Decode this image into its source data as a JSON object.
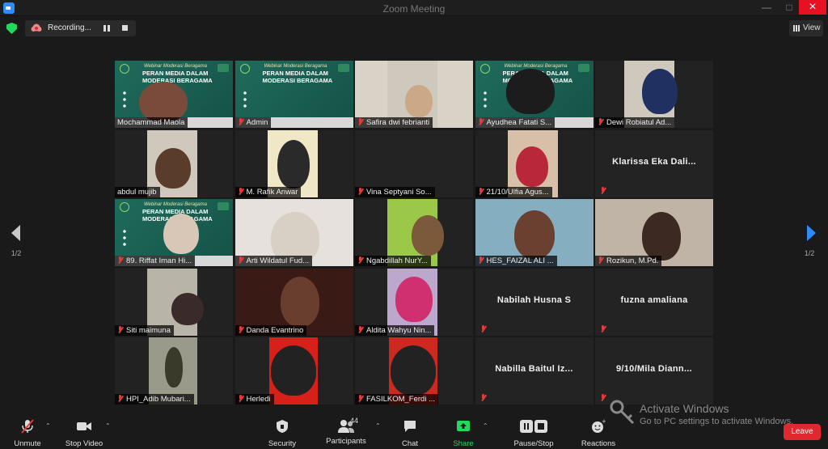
{
  "window": {
    "title": "Zoom Meeting",
    "minimize_icon": "minimize-icon",
    "maximize_icon": "maximize-icon",
    "close_icon": "close-icon"
  },
  "status": {
    "recording_label": "Recording...",
    "view_label": "View"
  },
  "pager": {
    "left": "1/2",
    "right": "1/2"
  },
  "participants": [
    {
      "name": "Mochammad Maola",
      "muted": false,
      "video": "banner"
    },
    {
      "name": "Admin",
      "muted": true,
      "video": "banner"
    },
    {
      "name": "Safira dwi febrianti",
      "muted": true,
      "video": "person"
    },
    {
      "name": "Ayudhea Fatati S...",
      "muted": true,
      "video": "banner"
    },
    {
      "name": "Dewi Robiatul Ad...",
      "muted": true,
      "video": "person"
    },
    {
      "name": "abdul mujib",
      "muted": false,
      "video": "person"
    },
    {
      "name": "M. Rafik Anwar",
      "muted": true,
      "video": "person"
    },
    {
      "name": "Vina Septyani So...",
      "muted": true,
      "video": "empty"
    },
    {
      "name": "21/10/Ulfia Agus...",
      "muted": true,
      "video": "person"
    },
    {
      "name": "Klarissa Eka Dali...",
      "muted": true,
      "video": "none"
    },
    {
      "name": "89. Riffat Iman Hi...",
      "muted": true,
      "video": "banner",
      "active": true
    },
    {
      "name": "Arti Wildatul Fud...",
      "muted": true,
      "video": "person"
    },
    {
      "name": "Ngabdillah NurY...",
      "muted": true,
      "video": "person"
    },
    {
      "name": "HES_FAIZAL ALI ...",
      "muted": true,
      "video": "person"
    },
    {
      "name": "Rozikun, M.Pd.",
      "muted": true,
      "video": "person"
    },
    {
      "name": "Siti maimuna",
      "muted": true,
      "video": "person"
    },
    {
      "name": "Danda Evantrino",
      "muted": true,
      "video": "person"
    },
    {
      "name": "Aldita Wahyu Nin...",
      "muted": true,
      "video": "person"
    },
    {
      "name": "Nabilah Husna S",
      "muted": true,
      "video": "none"
    },
    {
      "name": "fuzna amaliana",
      "muted": true,
      "video": "none"
    },
    {
      "name": "HPI_Adib Mubari...",
      "muted": true,
      "video": "person"
    },
    {
      "name": "Herledi",
      "muted": true,
      "video": "person"
    },
    {
      "name": "FASILKOM_Ferdi ...",
      "muted": true,
      "video": "person"
    },
    {
      "name": "Nabilla Baitul Iz...",
      "muted": true,
      "video": "none"
    },
    {
      "name": "9/10/Mila Diann...",
      "muted": true,
      "video": "none"
    }
  ],
  "banner": {
    "subtitle": "Webinar Moderasi Beragama",
    "line1": "PERAN MEDIA DALAM",
    "line2": "MODERASI BERAGAMA"
  },
  "toolbar": {
    "unmute": "Unmute",
    "stop_video": "Stop Video",
    "security": "Security",
    "participants": "Participants",
    "participants_count": "44",
    "chat": "Chat",
    "share_screen": "Share Screen",
    "recording": "Pause/Stop Recording",
    "reactions": "Reactions",
    "leave": "Leave"
  },
  "watermark": {
    "title": "Activate Windows",
    "subtitle": "Go to PC settings to activate Windows."
  },
  "colors": {
    "accent": "#2d8cff",
    "green": "#23d959",
    "active_speaker": "#c9e34b",
    "leave": "#e0282e",
    "muted_mic": "#e23c3c"
  }
}
